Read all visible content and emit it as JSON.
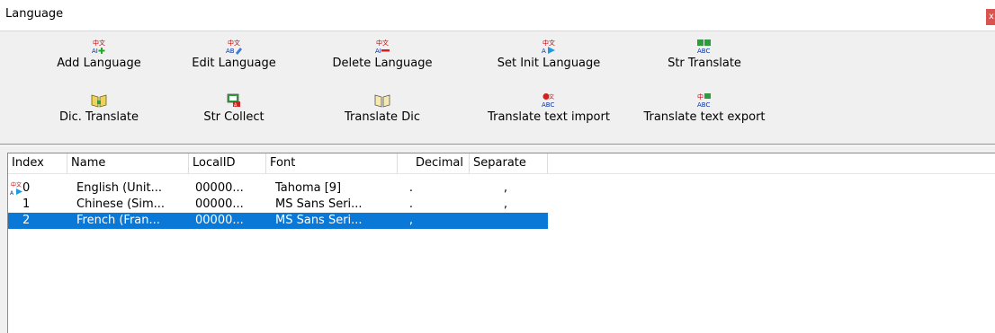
{
  "window": {
    "title": "Language",
    "close_glyph": "x"
  },
  "toolbar": {
    "buttons": [
      {
        "label": "Add Language",
        "icon": "add-language-icon"
      },
      {
        "label": "Edit Language",
        "icon": "edit-language-icon"
      },
      {
        "label": "Delete Language",
        "icon": "delete-language-icon"
      },
      {
        "label": "Set Init Language",
        "icon": "set-init-language-icon"
      },
      {
        "label": "Str Translate",
        "icon": "str-translate-icon"
      },
      {
        "label": "Dic. Translate",
        "icon": "dic-translate-icon"
      },
      {
        "label": "Str Collect",
        "icon": "str-collect-icon"
      },
      {
        "label": "Translate Dic",
        "icon": "translate-dic-icon"
      },
      {
        "label": "Translate text import",
        "icon": "translate-text-import-icon"
      },
      {
        "label": "Translate text export",
        "icon": "translate-text-export-icon"
      }
    ]
  },
  "table": {
    "columns": [
      "Index",
      "Name",
      "LocalID",
      "Font",
      "Decimal",
      "Separate"
    ],
    "rows": [
      {
        "index": "0",
        "name": "English (Unit...",
        "localid": "00000...",
        "font": "Tahoma [9]",
        "decimal": ".",
        "separate": ",",
        "init": true,
        "selected": false
      },
      {
        "index": "1",
        "name": "Chinese (Sim...",
        "localid": "00000...",
        "font": "MS Sans Seri...",
        "decimal": ".",
        "separate": ",",
        "init": false,
        "selected": false
      },
      {
        "index": "2",
        "name": "French (Fran...",
        "localid": "00000...",
        "font": "MS Sans Seri...",
        "decimal": ",",
        "separate": "",
        "init": false,
        "selected": true
      }
    ]
  },
  "colors": {
    "selection": "#0a78d7",
    "close": "#d9534f"
  }
}
